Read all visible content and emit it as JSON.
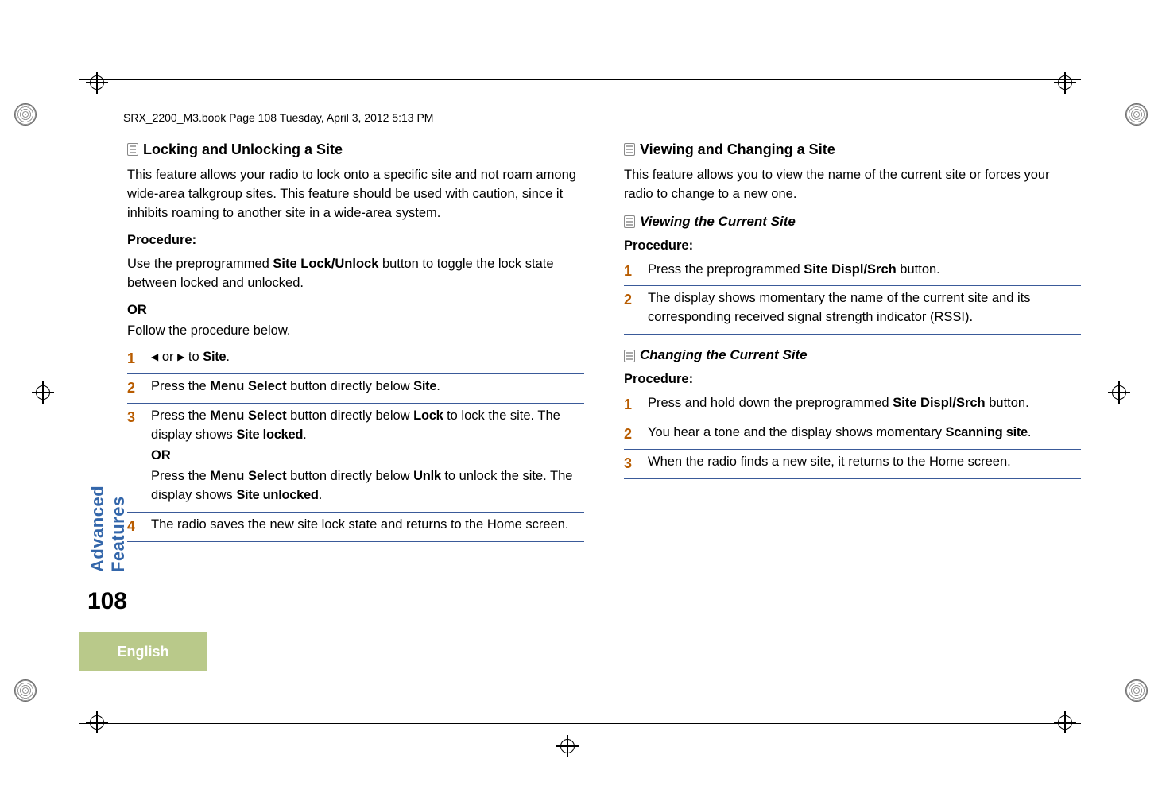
{
  "header": {
    "running": "SRX_2200_M3.book  Page 108  Tuesday, April 3, 2012  5:13 PM"
  },
  "side": {
    "vertical": "Advanced Features",
    "page_num": "108",
    "language": "English"
  },
  "left": {
    "h2": "Locking and Unlocking a Site",
    "intro": "This feature allows your radio to lock onto a specific site and not roam among wide-area talkgroup sites. This feature should be used with caution, since it inhibits roaming to another site in a wide-area system.",
    "proc": "Procedure:",
    "pre1a": "Use the preprogrammed ",
    "pre1b": "Site Lock/Unlock",
    "pre1c": " button to toggle the lock state between locked and unlocked.",
    "or": "OR",
    "pre2": "Follow the procedure below.",
    "s1_a": " or ",
    "s1_b": " to ",
    "s1_site": "Site",
    "s1_end": ".",
    "s2_a": "Press the ",
    "s2_b": "Menu Select",
    "s2_c": " button directly below ",
    "s2_site": "Site",
    "s2_end": ".",
    "s3_a": "Press the ",
    "s3_b": "Menu Select",
    "s3_c": " button directly below ",
    "s3_lock": "Lock",
    "s3_d": " to lock the site. The display shows ",
    "s3_locked": "Site locked",
    "s3_e": ".",
    "s3_or": "OR",
    "s3_f": "Press the ",
    "s3_g": "Menu Select",
    "s3_h": " button directly below ",
    "s3_unlk": "Unlk",
    "s3_i": " to unlock the site. The display shows ",
    "s3_unlocked": "Site unlocked",
    "s3_j": ".",
    "s4": "The radio saves the new site lock state and returns to the Home screen."
  },
  "right": {
    "h2": "Viewing and Changing a Site",
    "intro": "This feature allows you to view the name of the current site or forces your radio to change to a new one.",
    "h3a": "Viewing the Current Site",
    "procA": "Procedure:",
    "a1_a": "Press the preprogrammed ",
    "a1_b": "Site Displ/Srch",
    "a1_c": " button.",
    "a2": "The display shows momentary the name of the current site and its corresponding received signal strength indicator (RSSI).",
    "h3b": "Changing the Current Site",
    "procB": "Procedure:",
    "b1_a": "Press and hold down the preprogrammed ",
    "b1_b": "Site Displ/Srch",
    "b1_c": " button.",
    "b2_a": "You hear a tone and the display shows momentary ",
    "b2_b": "Scanning site",
    "b2_c": ".",
    "b3": "When the radio finds a new site, it returns to the Home screen."
  },
  "nums": {
    "n1": "1",
    "n2": "2",
    "n3": "3",
    "n4": "4"
  },
  "glyphs": {
    "left_tri": "◀",
    "right_tri": "▶"
  }
}
